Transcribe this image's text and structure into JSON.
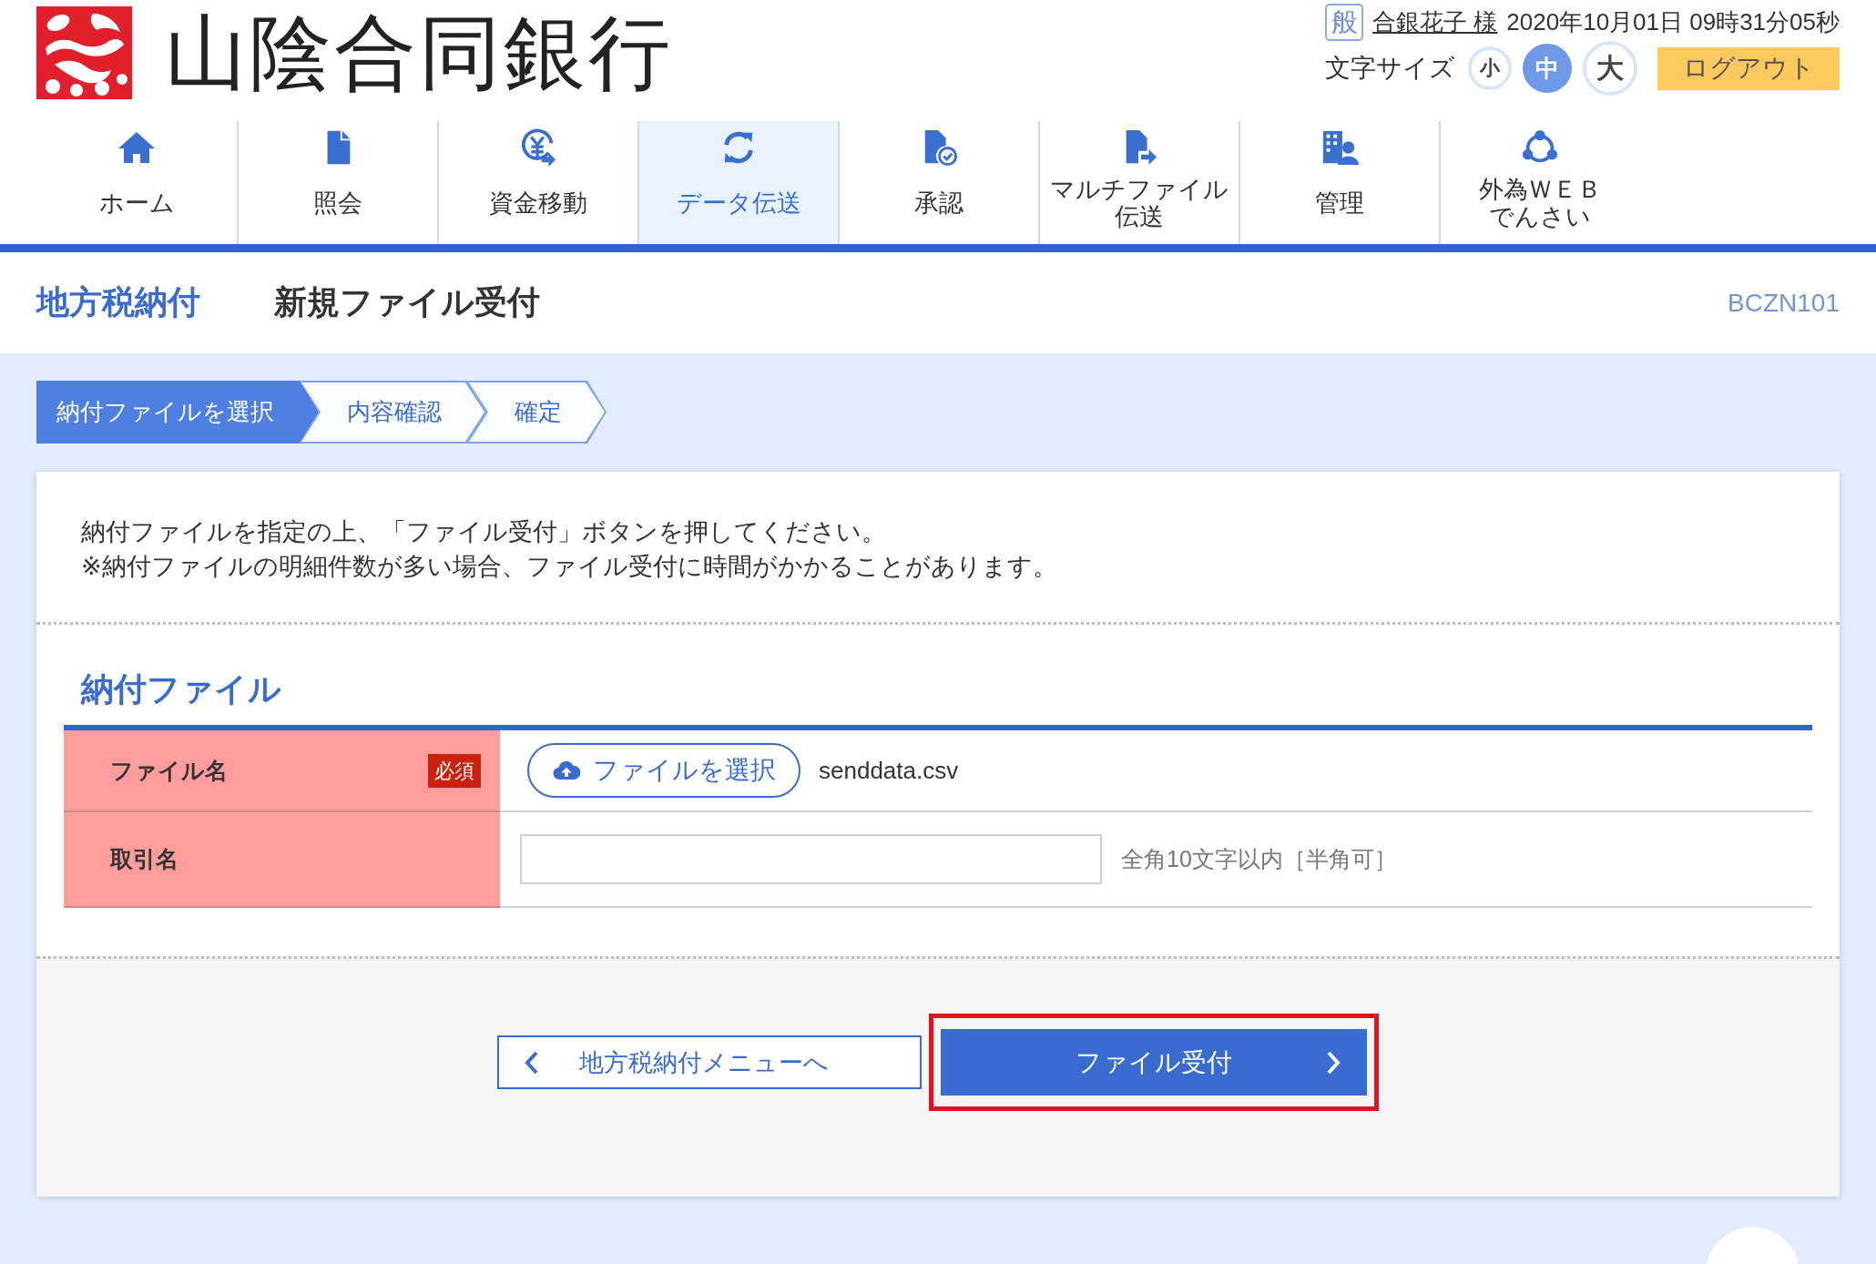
{
  "header": {
    "bank_name": "山陰合同銀行",
    "user_type": "般",
    "user_name": "合銀花子 様",
    "datetime": "2020年10月01日 09時31分05秒",
    "font_size_label": "文字サイズ",
    "font_sizes": [
      {
        "label": "小",
        "selected": false
      },
      {
        "label": "中",
        "selected": true
      },
      {
        "label": "大",
        "selected": false
      }
    ],
    "logout": "ログアウト"
  },
  "nav": [
    {
      "label": "ホーム",
      "selected": false
    },
    {
      "label": "照会",
      "selected": false
    },
    {
      "label": "資金移動",
      "selected": false
    },
    {
      "label": "データ伝送",
      "selected": true
    },
    {
      "label": "承認",
      "selected": false
    },
    {
      "label": "マルチファイル伝送",
      "selected": false
    },
    {
      "label": "管理",
      "selected": false
    },
    {
      "label": "外為ＷＥＢでんさい",
      "selected": false
    }
  ],
  "page": {
    "section": "地方税納付",
    "title": "新規ファイル受付",
    "screen_id": "BCZN101"
  },
  "steps": [
    {
      "label": "納付ファイルを選択",
      "selected": true
    },
    {
      "label": "内容確認",
      "selected": false
    },
    {
      "label": "確定",
      "selected": false
    }
  ],
  "instructions": [
    "納付ファイルを指定の上、「ファイル受付」ボタンを押してください。",
    "※納付ファイルの明細件数が多い場合、ファイル受付に時間がかかることがあります。"
  ],
  "form": {
    "title": "納付ファイル",
    "rows": [
      {
        "kind": "file",
        "label": "ファイル名",
        "badge": "必須",
        "button": "ファイルを選択",
        "value": "senddata.csv"
      },
      {
        "kind": "text",
        "label": "取引名",
        "hint": "全角10文字以内［半角可］"
      }
    ]
  },
  "buttons": [
    {
      "kind": "back",
      "label": "地方税納付メニューへ",
      "highlighted": false
    },
    {
      "kind": "primary",
      "label": "ファイル受付",
      "highlighted": true
    }
  ]
}
